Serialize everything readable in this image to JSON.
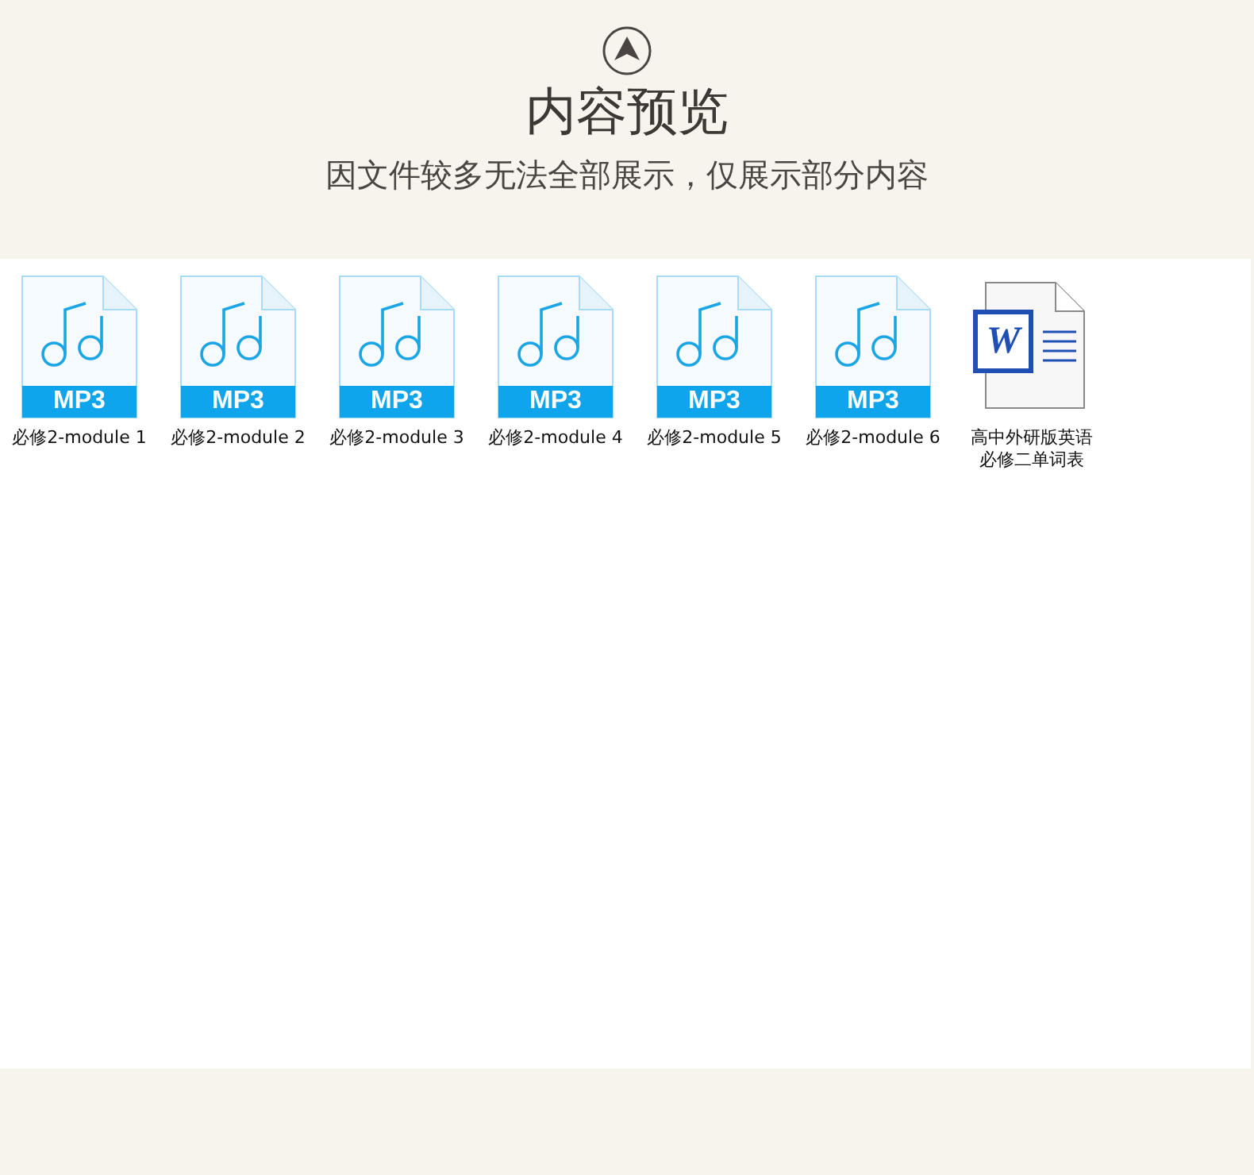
{
  "header": {
    "title": "内容预览",
    "subtitle": "因文件较多无法全部展示，仅展示部分内容"
  },
  "files": [
    {
      "kind": "mp3",
      "badge": "MP3",
      "name": "必修2-module 1"
    },
    {
      "kind": "mp3",
      "badge": "MP3",
      "name": "必修2-module 2"
    },
    {
      "kind": "mp3",
      "badge": "MP3",
      "name": "必修2-module 3"
    },
    {
      "kind": "mp3",
      "badge": "MP3",
      "name": "必修2-module 4"
    },
    {
      "kind": "mp3",
      "badge": "MP3",
      "name": "必修2-module 5"
    },
    {
      "kind": "mp3",
      "badge": "MP3",
      "name": "必修2-module 6"
    },
    {
      "kind": "word",
      "badge": "W",
      "name": "高中外研版英语必修二单词表"
    }
  ]
}
